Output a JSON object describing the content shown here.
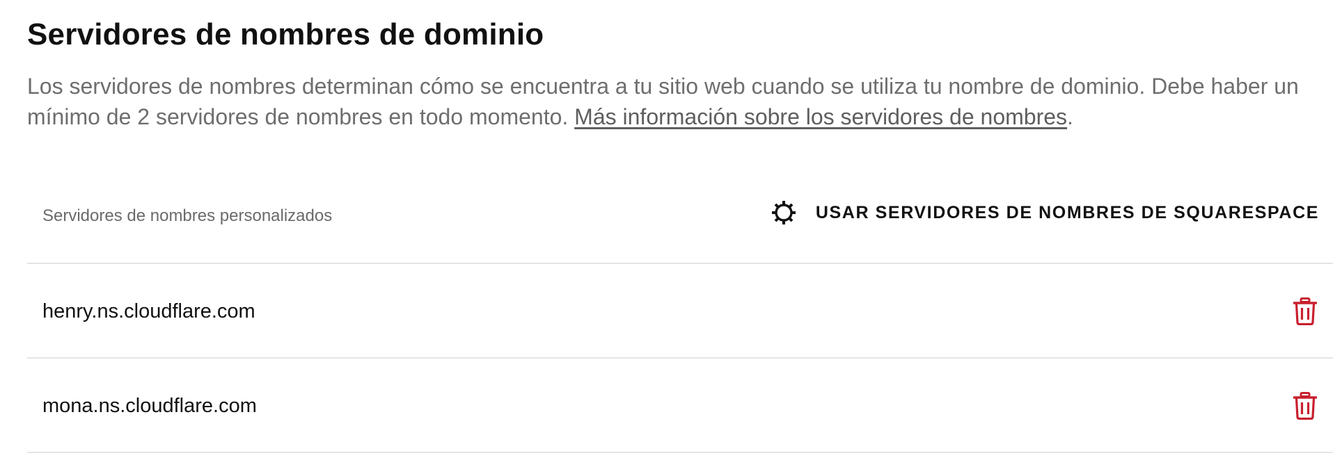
{
  "header": {
    "title": "Servidores de nombres de dominio",
    "description": "Los servidores de nombres determinan cómo se encuentra a tu sitio web cuando se utiliza tu nombre de dominio. Debe haber un mínimo de 2 servidores de nombres en todo momento. ",
    "link_text": "Más información sobre los servidores de nombres",
    "description_end": "."
  },
  "section": {
    "label": "Servidores de nombres personalizados",
    "action_label": "USAR SERVIDORES DE NOMBRES DE SQUARESPACE",
    "action_icon": "gear-icon"
  },
  "nameservers": [
    {
      "name": "henry.ns.cloudflare.com",
      "action_icon": "trash-icon"
    },
    {
      "name": "mona.ns.cloudflare.com",
      "action_icon": "trash-icon"
    }
  ],
  "colors": {
    "delete": "#c8202f",
    "text": "#111111",
    "muted": "#6e6e6e",
    "divider": "#e4e4e4"
  }
}
